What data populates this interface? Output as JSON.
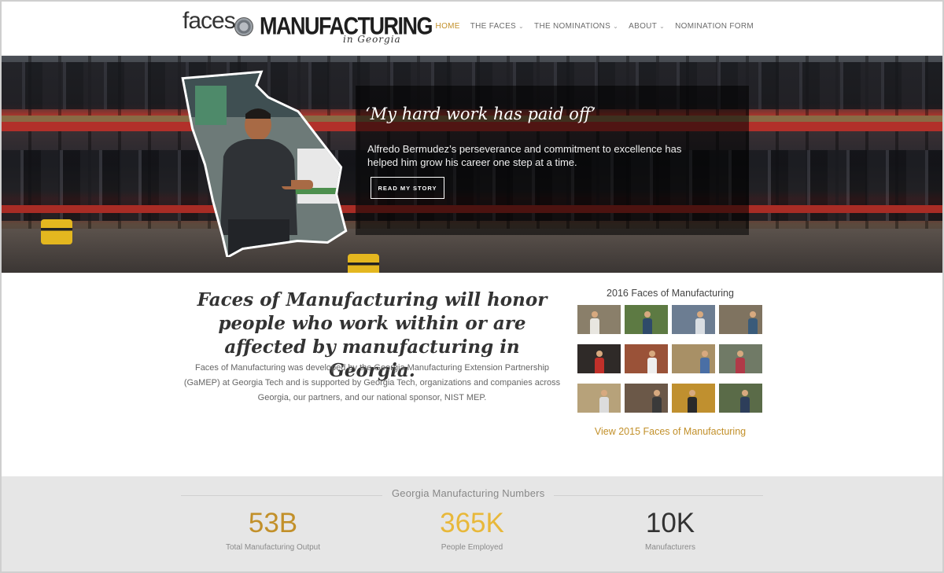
{
  "logo": {
    "faces": "faces",
    "of": "of",
    "manufacturing": "MANUFACTURING",
    "location": "in Georgia"
  },
  "nav": {
    "items": [
      {
        "label": "HOME",
        "active": true,
        "dropdown": false
      },
      {
        "label": "THE FACES",
        "active": false,
        "dropdown": true
      },
      {
        "label": "THE NOMINATIONS",
        "active": false,
        "dropdown": true
      },
      {
        "label": "ABOUT",
        "active": false,
        "dropdown": true
      },
      {
        "label": "NOMINATION FORM",
        "active": false,
        "dropdown": false
      }
    ],
    "chevron": "⌄"
  },
  "hero": {
    "quote": "‘My hard work has paid off’",
    "text": "Alfredo Bermudez’s perseverance and commitment to excellence has helped him grow his career one step at a time.",
    "button": "READ MY STORY"
  },
  "intro": {
    "heading": "Faces of Manufacturing will honor people who work within or are affected by manufacturing in Georgia.",
    "body": "Faces of Manufacturing was developed by the Georgia Manufacturing Extension Partnership (GaMEP) at Georgia Tech and is supported by Georgia Tech, organizations and companies across Georgia, our partners, and our national sponsor, NIST MEP."
  },
  "gallery": {
    "title": "2016 Faces of Manufacturing",
    "link": "View 2015 Faces of Manufacturing",
    "thumbs": [
      {
        "bg": "#8a7f6a",
        "shirt": "#e8e6e0"
      },
      {
        "bg": "#5d7a43",
        "shirt": "#2f4a6a"
      },
      {
        "bg": "#6c7d92",
        "shirt": "#d9dde2"
      },
      {
        "bg": "#7f7360",
        "shirt": "#3a5b7a"
      },
      {
        "bg": "#2f2a28",
        "shirt": "#c0302a"
      },
      {
        "bg": "#9a5238",
        "shirt": "#eeeeee"
      },
      {
        "bg": "#a89066",
        "shirt": "#4a6fa5"
      },
      {
        "bg": "#707a66",
        "shirt": "#b03a48"
      },
      {
        "bg": "#b7a27a",
        "shirt": "#dcdcdc"
      },
      {
        "bg": "#6b5848",
        "shirt": "#3a3a3a"
      },
      {
        "bg": "#c0902f",
        "shirt": "#2a2a2a"
      },
      {
        "bg": "#5a6b48",
        "shirt": "#2d3e5a"
      }
    ]
  },
  "stats": {
    "title": "Georgia Manufacturing Numbers",
    "items": [
      {
        "value": "53B",
        "label": "Total Manufacturing Output",
        "color": "#c2902a"
      },
      {
        "value": "365K",
        "label": "People Employed",
        "color": "#e8b83a"
      },
      {
        "value": "10K",
        "label": "Manufacturers",
        "color": "#333333"
      }
    ]
  },
  "colors": {
    "accent": "#c2902a",
    "nav_text": "#6b6b6b",
    "stats_bg": "#e6e6e6"
  }
}
